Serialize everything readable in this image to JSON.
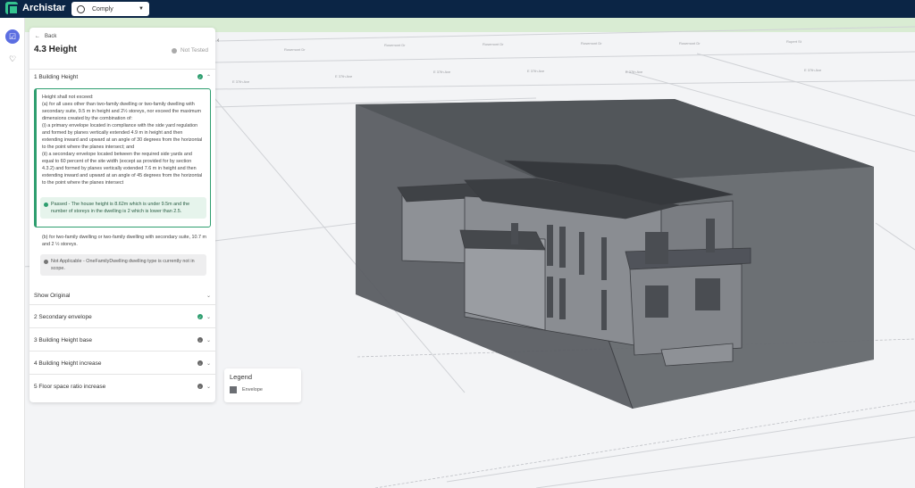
{
  "app": {
    "name": "Archistar"
  },
  "mode_select": {
    "value": "Comply"
  },
  "panel": {
    "back_label": "Back",
    "title": "4.3 Height",
    "status": "Not Tested",
    "sections": [
      {
        "label": "1 Building Height",
        "state": "pass",
        "expanded": true
      },
      {
        "label": "2 Secondary envelope",
        "state": "pass"
      },
      {
        "label": "3 Building Height base",
        "state": "info"
      },
      {
        "label": "4 Building Height increase",
        "state": "info"
      },
      {
        "label": "5 Floor space ratio increase",
        "state": "info"
      }
    ],
    "rule_text": "Height shall not exceed:\n(a) for all uses other than two-family dwelling or two-family dwelling with secondary suite, 9.5 m in height and 2½ storeys, nor exceed the maximum dimensions created by the combination of:\n(i) a primary envelope located in compliance with the side yard regulation and formed by planes vertically extended 4.9 m in height and then extending inward and upward at an angle of 30 degrees from the horizontal to the point where the planes intersect; and\n(ii) a secondary envelope located between the required side yards and equal to 60 percent of the site width (except as provided for by section 4.3.2) and formed by planes vertically extended 7.6 m in height and then extending inward and upward at an angle of 45 degrees from the horizontal to the point where the planes intersect",
    "passed_text": "Passed - The house height is 8.62m which is under 9.5m and the number of storeys in the dwelling is 2 which is lower than 2.5.",
    "rule_b_text": "(b) for two-family dwelling or two-family dwelling with secondary suite, 10.7 m and 2 ½ storeys.",
    "na_text": "Not Applicable - OneFamilyDwelling dwelling type is currently not in scope.",
    "show_original_label": "Show Original"
  },
  "legend": {
    "title": "Legend",
    "items": [
      {
        "label": "Envelope",
        "color": "#6b6e73"
      }
    ]
  },
  "colors": {
    "topbar": "#0b2545",
    "accent": "#5b6ee1",
    "pass": "#2e9e6f",
    "map_green": "#d9ecd3"
  }
}
